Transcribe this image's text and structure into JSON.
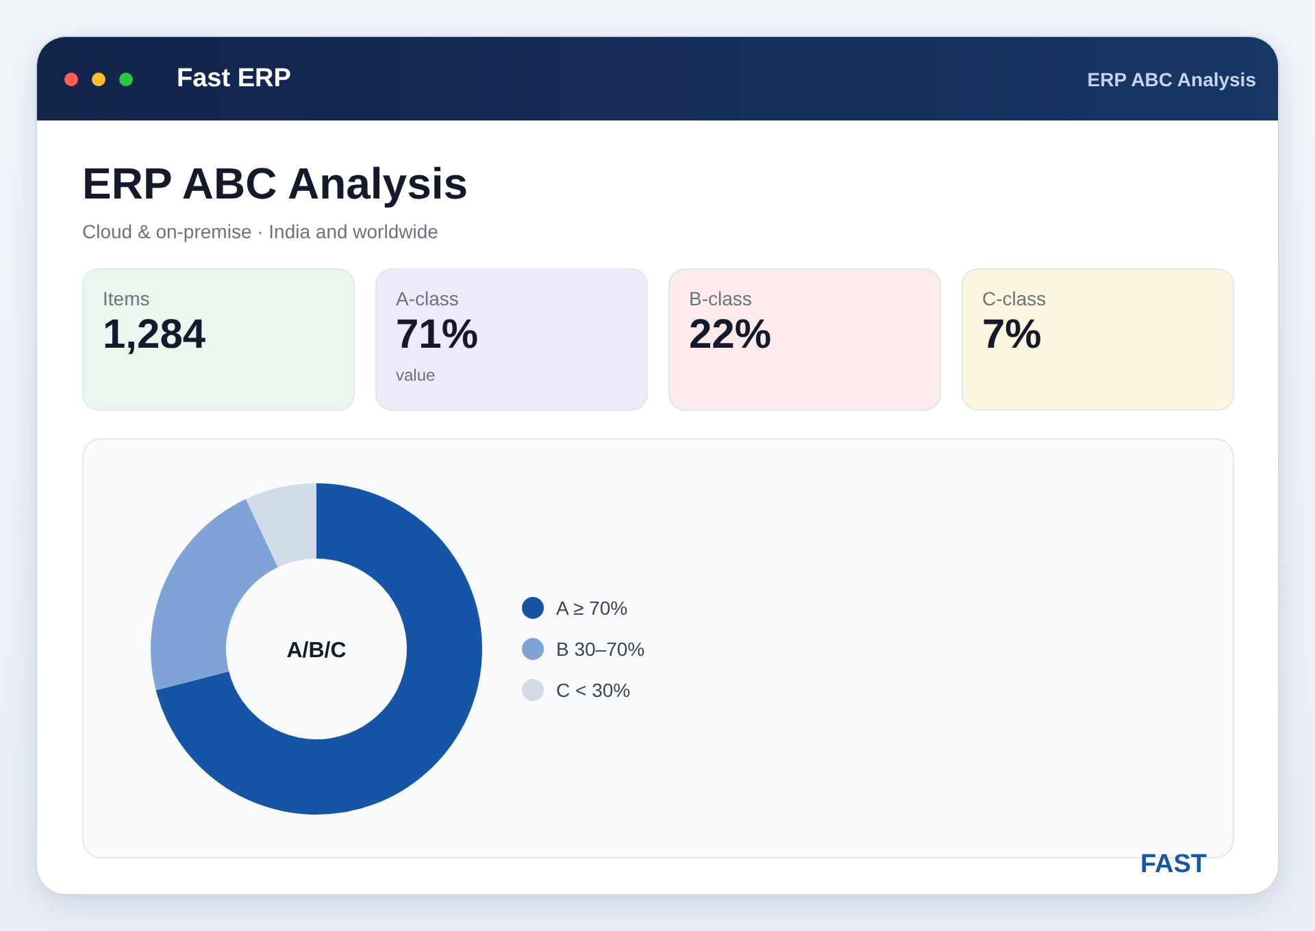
{
  "window": {
    "app_name": "Fast ERP",
    "title": "ERP ABC Analysis"
  },
  "header": {
    "title": "ERP ABC Analysis",
    "subtitle": "Cloud & on-premise · India and worldwide"
  },
  "stats": [
    {
      "label": "Items",
      "value": "1,284",
      "color": "#ecf5ee"
    },
    {
      "label": "A-class",
      "value": "71%",
      "note": "value",
      "color": "#eee9fb"
    },
    {
      "label": "B-class",
      "value": "22%",
      "color": "#fdeaea"
    },
    {
      "label": "C-class",
      "value": "7%",
      "color": "#fcf6e0"
    }
  ],
  "chart": {
    "chart_data": {
      "type": "donut",
      "title": "A/B/C",
      "categories": [
        "A ≥ 70%",
        "B 30–70%",
        "C < 30%"
      ],
      "values": [
        71,
        22,
        7
      ],
      "colors": [
        "#1655a5",
        "#7fa3d6",
        "#d1dbe7"
      ]
    }
  },
  "brand": "FAST"
}
